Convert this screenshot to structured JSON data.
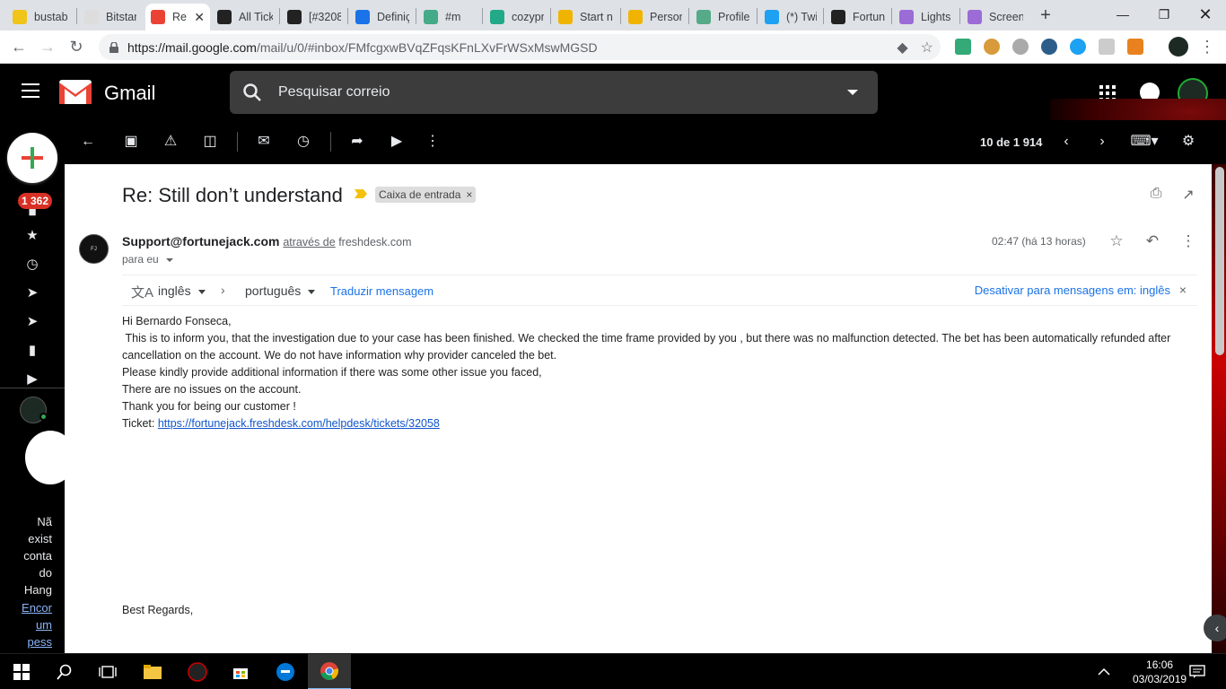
{
  "browser": {
    "tabs": [
      {
        "title": "bustab",
        "fav": "#f0c419"
      },
      {
        "title": "Bitstan",
        "fav": "#ddd"
      },
      {
        "title": "Re",
        "fav": "#ea4335",
        "active": true
      },
      {
        "title": "All Tick",
        "fav": "#222"
      },
      {
        "title": "[#3208",
        "fav": "#222"
      },
      {
        "title": "Definiç",
        "fav": "#1a73e8"
      },
      {
        "title": "#m",
        "fav": "#4a8"
      },
      {
        "title": "cozypr",
        "fav": "#2a8"
      },
      {
        "title": "Start n",
        "fav": "#f0b400"
      },
      {
        "title": "Person",
        "fav": "#f0b400"
      },
      {
        "title": "Profile",
        "fav": "#5a8"
      },
      {
        "title": "(*) Twi",
        "fav": "#1da1f2"
      },
      {
        "title": "Fortun",
        "fav": "#222"
      },
      {
        "title": "Lights",
        "fav": "#9b6bd6"
      },
      {
        "title": "Screen",
        "fav": "#9b6bd6"
      }
    ],
    "url_main": "https://mail.google.com",
    "url_path": "/mail/u/0/#inbox/FMfcgxwBVqZFqsKFnLXvFrWSxMswMGSD"
  },
  "gmail": {
    "app_name": "Gmail",
    "search_placeholder": "Pesquisar correio",
    "unread_count": "1 362",
    "counter": "10 de 1 914"
  },
  "hangouts": {
    "text_lines": [
      "Nã",
      "exist",
      "conta",
      "do",
      "Hang"
    ],
    "link_lines": [
      "Encor",
      "um",
      "pess"
    ]
  },
  "email": {
    "subject": "Re: Still don’t understand",
    "label": "Caixa de entrada",
    "sender": "Support@fortunejack.com",
    "via_text": "através de",
    "via_domain": "freshdesk.com",
    "to_text": "para eu",
    "time": "02:47 (há 13 horas)",
    "translate": {
      "from_lang": "inglês",
      "to_lang": "português",
      "translate_link": "Traduzir mensagem",
      "disable_text": "Desativar para mensagens em: inglês"
    },
    "body": {
      "greeting": "Hi Bernardo Fonseca,",
      "para1": " This is to inform you, that the investigation due to your case has been finished. We checked the time frame provided by you , but there was no malfunction detected. The bet has been automatically refunded after cancellation on the account. We do not have information why provider canceled the bet.",
      "line2": "Please kindly provide additional information if there was some other issue you faced,",
      "line3": "There are no issues on the account.",
      "line4": "Thank you for being our customer !",
      "ticket_label": "Ticket: ",
      "ticket_link": "https://fortunejack.freshdesk.com/helpdesk/tickets/32058",
      "regards": "Best Regards,"
    }
  },
  "taskbar": {
    "time": "16:06",
    "date": "03/03/2019"
  }
}
